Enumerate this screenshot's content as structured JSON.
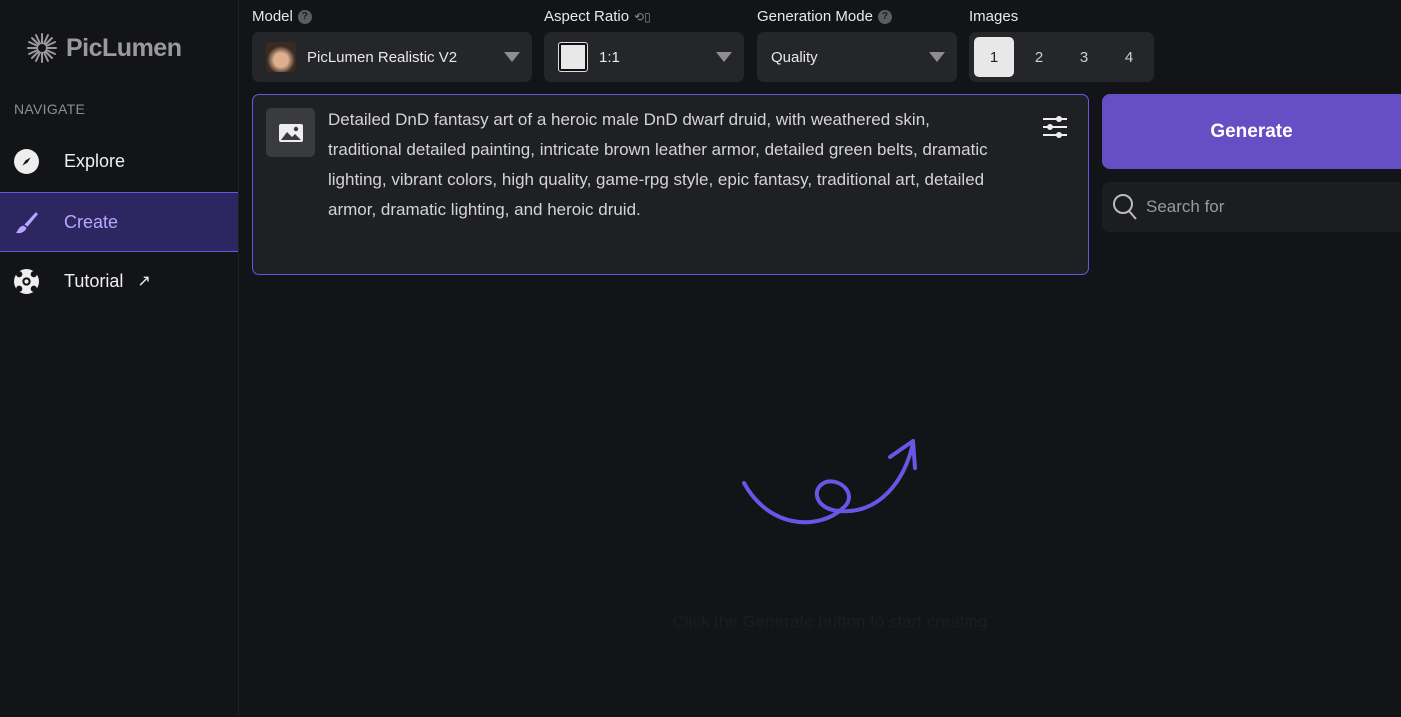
{
  "app": {
    "name": "PicLumen"
  },
  "sidebar": {
    "section_title": "NAVIGATE",
    "items": [
      {
        "label": "Explore",
        "icon": "compass-icon"
      },
      {
        "label": "Create",
        "icon": "brush-icon",
        "active": true
      },
      {
        "label": "Tutorial",
        "icon": "lifebuoy-icon",
        "external": true
      }
    ]
  },
  "controls": {
    "model": {
      "label": "Model",
      "value": "PicLumen Realistic V2"
    },
    "aspect_ratio": {
      "label": "Aspect Ratio",
      "value": "1:1"
    },
    "generation_mode": {
      "label": "Generation Mode",
      "value": "Quality"
    },
    "images": {
      "label": "Images",
      "options": [
        "1",
        "2",
        "3",
        "4"
      ],
      "selected": "1"
    }
  },
  "prompt": {
    "text": "Detailed DnD fantasy art of a heroic male DnD dwarf druid, with weathered skin, traditional detailed painting, intricate brown leather armor, detailed green belts, dramatic lighting, vibrant colors, high quality, game-rpg style, epic fantasy, traditional art, detailed armor, dramatic lighting, and heroic druid."
  },
  "generate_label": "Generate",
  "search": {
    "placeholder": "Search for"
  },
  "empty_state": {
    "hint": "Click the Generate button to start creating"
  },
  "colors": {
    "accent": "#664fc4",
    "border": "#6b55e6",
    "active_bg": "#2e2660"
  }
}
